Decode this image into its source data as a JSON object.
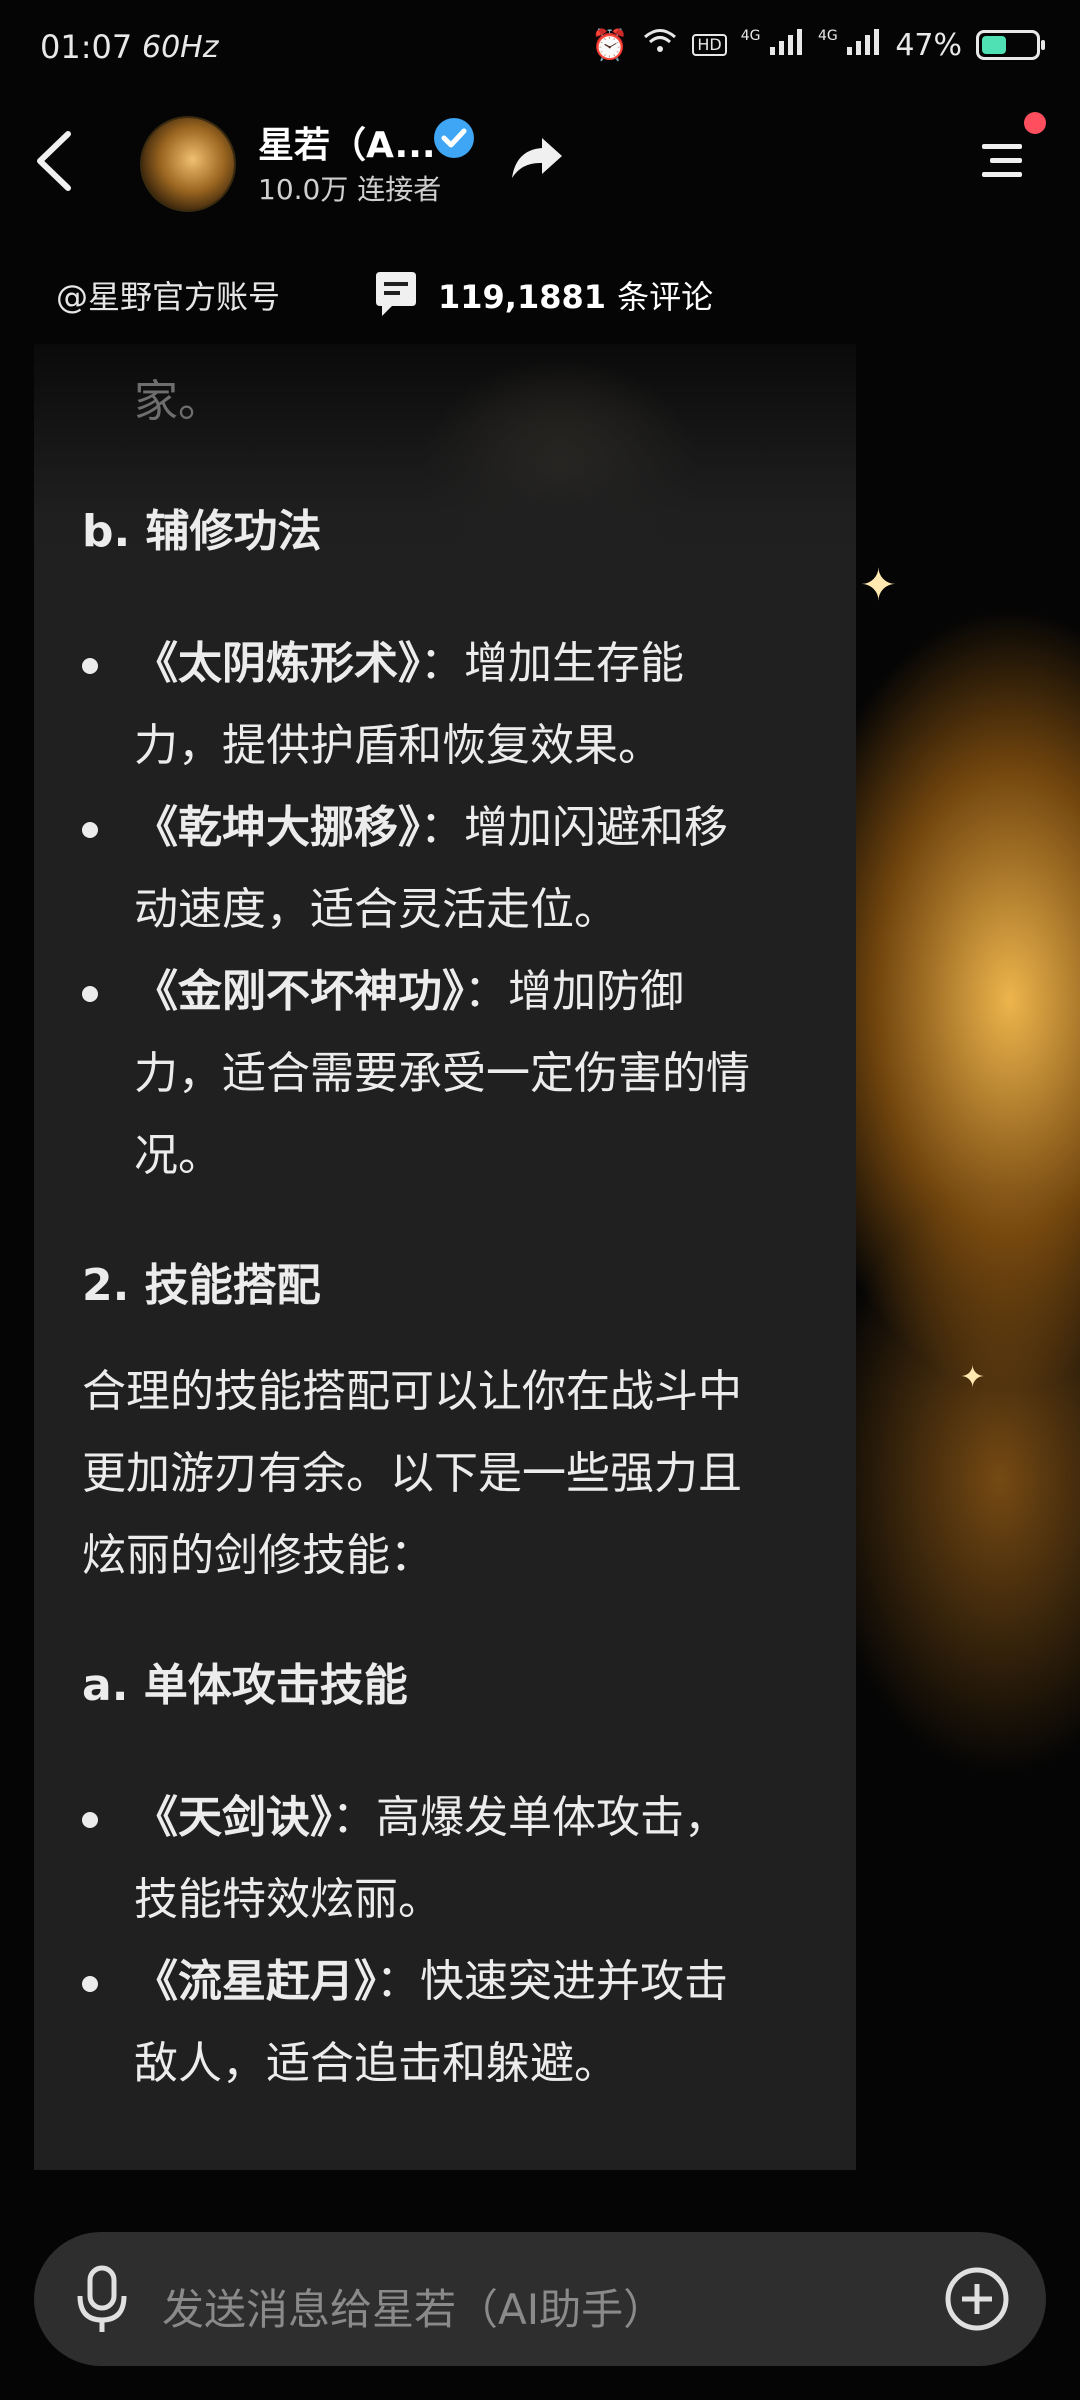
{
  "status_bar": {
    "time": "01:07",
    "refresh": "60Hz",
    "network": "4G",
    "battery_percent": "47%",
    "battery_level": 0.47
  },
  "header": {
    "title": "星若（A...",
    "subtitle": "10.0万 连接者"
  },
  "info": {
    "account": "@星野官方账号",
    "comment_count": "119,1881",
    "comment_unit": "条评论"
  },
  "content": {
    "lines": [
      "家。",
      "b. 辅修功法",
      "《太阴炼形术》",
      "：增加生存能",
      "力，提供护盾和恢复效果。",
      "《乾坤大挪移》",
      "：增加闪避和移",
      "动速度，适合灵活走位。",
      "《金刚不坏神功》",
      "：增加防御",
      "力，适合需要承受一定伤害的情",
      "况。",
      "2. 技能搭配",
      "合理的技能搭配可以让你在战斗中",
      "更加游刃有余。以下是一些强力且",
      "炫丽的剑修技能：",
      "a. 单体攻击技能",
      "《天剑诀》",
      "：高爆发单体攻击，",
      "技能特效炫丽。",
      "《流星赶月》",
      "：快速突进并攻击",
      "敌人，适合追击和躲避。"
    ]
  },
  "input": {
    "placeholder": "发送消息给星若（AI助手）"
  },
  "colors": {
    "accent_verified": "#3ea6f5",
    "notification_dot": "#ff4f5e",
    "battery": "#4fe0b4"
  }
}
